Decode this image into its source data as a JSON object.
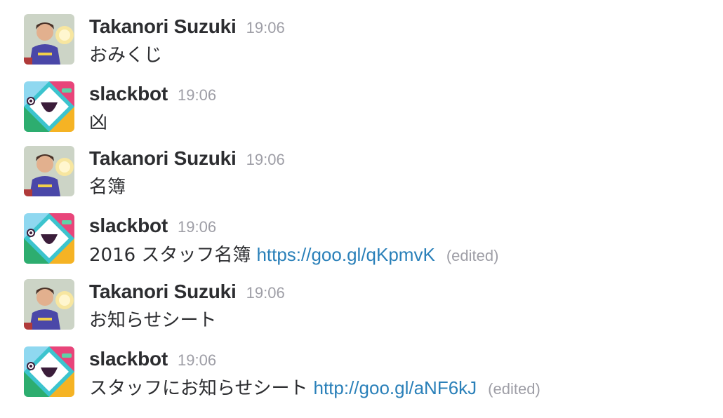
{
  "messages": [
    {
      "sender": "Takanori Suzuki",
      "time": "19:06",
      "text": "おみくじ",
      "link": "",
      "edited": "",
      "avatar": "user-photo"
    },
    {
      "sender": "slackbot",
      "time": "19:06",
      "text": "凶",
      "link": "",
      "edited": "",
      "avatar": "slackbot-logo"
    },
    {
      "sender": "Takanori Suzuki",
      "time": "19:06",
      "text": "名簿",
      "link": "",
      "edited": "",
      "avatar": "user-photo"
    },
    {
      "sender": "slackbot",
      "time": "19:06",
      "text": "2016 スタッフ名簿",
      "link": "https://goo.gl/qKpmvK",
      "edited": "(edited)",
      "avatar": "slackbot-logo"
    },
    {
      "sender": "Takanori Suzuki",
      "time": "19:06",
      "text": "お知らせシート",
      "link": "",
      "edited": "",
      "avatar": "user-photo"
    },
    {
      "sender": "slackbot",
      "time": "19:06",
      "text": "スタッフにお知らせシート",
      "link": "http://goo.gl/aNF6kJ",
      "edited": "(edited)",
      "avatar": "slackbot-logo"
    }
  ],
  "colors": {
    "link": "#2a80b9",
    "muted": "#9e9ea6",
    "text": "#2c2d30"
  }
}
